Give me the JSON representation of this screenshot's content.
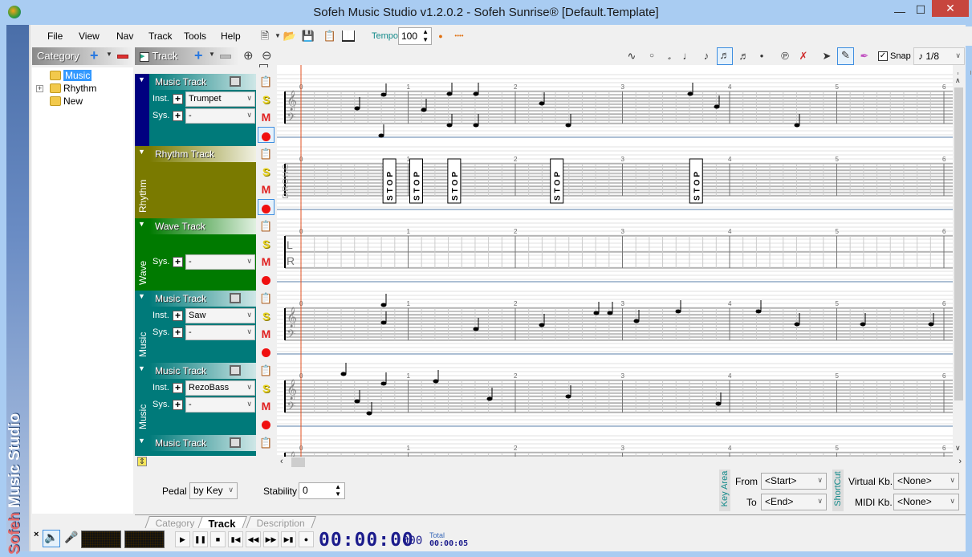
{
  "window": {
    "title": "Sofeh Music Studio v1.2.0.2 - Sofeh Sunrise®  [Default.Template]",
    "brand_sofeh": "Sofeh",
    "brand_rest": " Music Studio"
  },
  "menu": [
    "File",
    "View",
    "Nav",
    "Track",
    "Tools",
    "Help"
  ],
  "toolbar": {
    "tempo_label": "Tempo",
    "tempo_value": "100",
    "snap_label": "Snap",
    "snap_checked": true,
    "note_value": "1/8",
    "note_tools": [
      "curve",
      "whole",
      "half",
      "quarter",
      "eighth",
      "sixteenth",
      "thirty-second",
      "dot"
    ],
    "selected_note_tool": "sixteenth",
    "edit_tools": [
      "pointer",
      "pencil",
      "eraser"
    ],
    "selected_edit_tool": "pencil"
  },
  "category_panel": {
    "title": "Category",
    "tree": [
      {
        "label": "Music",
        "selected": true,
        "expandable": false
      },
      {
        "label": "Rhythm",
        "selected": false,
        "expandable": true
      },
      {
        "label": "New",
        "selected": false,
        "expandable": false
      }
    ]
  },
  "track_panel": {
    "title": "Track",
    "tracks": [
      {
        "type": "Music",
        "side_label": "",
        "title": "Music Track",
        "color": "#007a7a",
        "side_color": "#000080",
        "inst_label": "Inst.",
        "inst": "Trumpet",
        "sys_label": "Sys.",
        "sys": "-"
      },
      {
        "type": "Rhythm",
        "side_label": "Rhythm",
        "title": "Rhythm Track",
        "color": "#7a7a00",
        "side_color": "#7a7a00"
      },
      {
        "type": "Wave",
        "side_label": "Wave",
        "title": "Wave Track",
        "color": "#007a00",
        "side_color": "#007a00",
        "sys_label": "Sys.",
        "sys": "-"
      },
      {
        "type": "Music",
        "side_label": "Music",
        "title": "Music Track",
        "color": "#007a7a",
        "side_color": "#007a7a",
        "inst_label": "Inst.",
        "inst": "Saw",
        "sys_label": "Sys.",
        "sys": "-"
      },
      {
        "type": "Music",
        "side_label": "Music",
        "title": "Music Track",
        "color": "#007a7a",
        "side_color": "#007a7a",
        "inst_label": "Inst.",
        "inst": "RezoBass",
        "sys_label": "Sys.",
        "sys": "-"
      },
      {
        "type": "Music",
        "side_label": "",
        "title": "Music Track",
        "color": "#007a7a",
        "side_color": "#007a7a"
      }
    ],
    "solo_label": "S",
    "mute_label": "M"
  },
  "score": {
    "measure_numbers": [
      "0",
      "1",
      "2",
      "3",
      "4",
      "5",
      "6"
    ],
    "chord_label": "CHORD",
    "wave_channels": [
      "L",
      "R"
    ],
    "stop_label": "STOP",
    "stop_positions": [
      0.75,
      1.0,
      1.25,
      2.2,
      3.5
    ]
  },
  "bottom_props": {
    "pedal_label": "Pedal",
    "pedal_value": "by Key",
    "stability_label": "Stability",
    "stability_value": "0",
    "key_area_label": "Key Area",
    "from_label": "From",
    "from_value": "<Start>",
    "to_label": "To",
    "to_value": "<End>",
    "shortcut_label": "ShortCut",
    "virtual_kb_label": "Virtual Kb.",
    "virtual_kb_value": "<None>",
    "midi_kb_label": "MIDI Kb.",
    "midi_kb_value": "<None>"
  },
  "tabs": [
    {
      "label": "Category",
      "active": false
    },
    {
      "label": "Track",
      "active": true
    },
    {
      "label": "Description",
      "active": false
    }
  ],
  "transport": {
    "time": "00:00:00",
    "ms": "000",
    "total_label": "Total",
    "total_value": "00:00:05",
    "buttons": [
      "play",
      "pause",
      "stop",
      "go-start",
      "rewind",
      "fast-forward",
      "go-end",
      "record"
    ],
    "close_symbol": "×"
  }
}
